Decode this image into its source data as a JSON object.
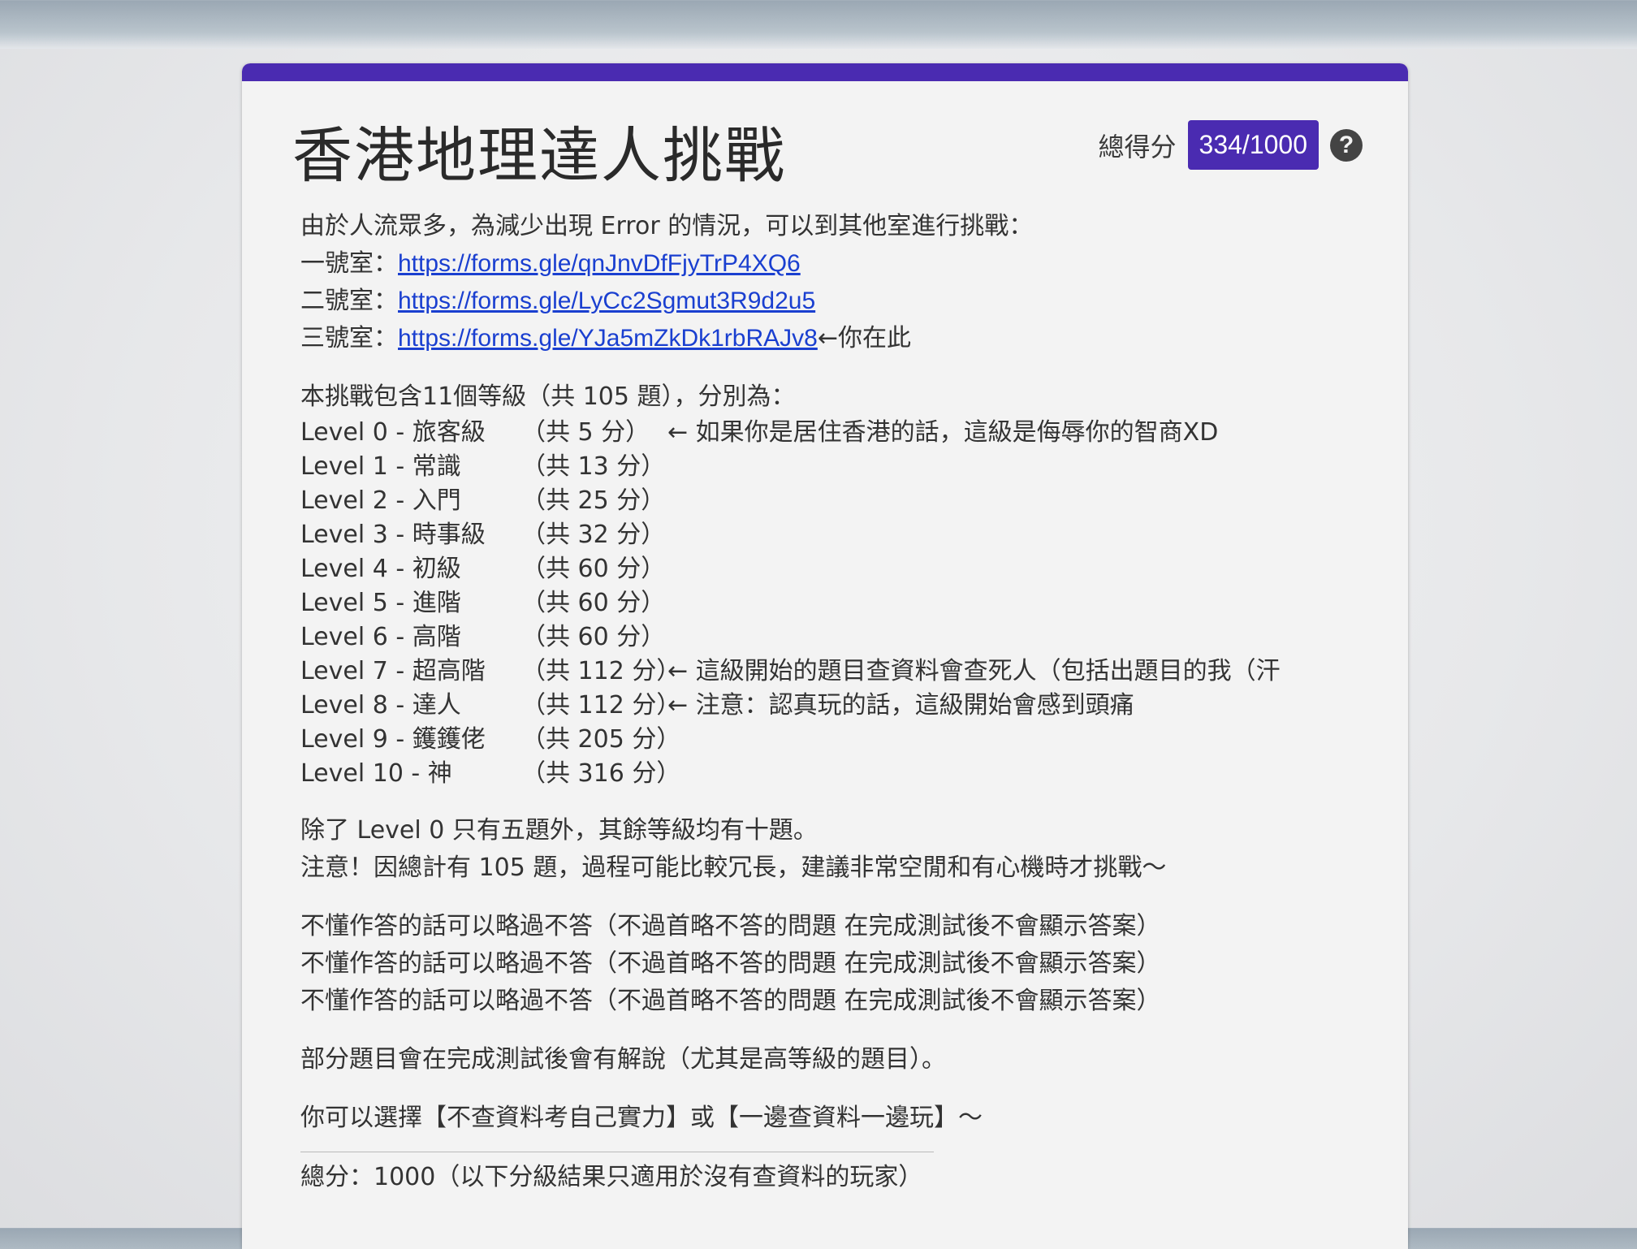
{
  "form": {
    "title": "香港地理達人挑戰",
    "score_label": "總得分",
    "score_value": "334/1000",
    "help_symbol": "?"
  },
  "rooms": {
    "intro": "由於人流眾多，為減少出現 Error 的情況，可以到其他室進行挑戰：",
    "items": [
      {
        "label": "一號室：",
        "url": "https://forms.gle/qnJnvDfFjyTrP4XQ6",
        "note": ""
      },
      {
        "label": "二號室：",
        "url": "https://forms.gle/LyCc2Sgmut3R9d2u5",
        "note": ""
      },
      {
        "label": "三號室：",
        "url": "https://forms.gle/YJa5mZkDk1rbRAJv8",
        "note": "←你在此"
      }
    ]
  },
  "levels": {
    "intro": "本挑戰包含11個等級（共 105 題），分別為：",
    "items": [
      {
        "name": "Level 0 - 旅客級",
        "points": "（共 5 分）",
        "note": "← 如果你是居住香港的話，這級是侮辱你的智商XD"
      },
      {
        "name": "Level 1 - 常識",
        "points": "（共 13 分）",
        "note": ""
      },
      {
        "name": "Level 2 - 入門",
        "points": "（共 25 分）",
        "note": ""
      },
      {
        "name": "Level 3 - 時事級",
        "points": "（共 32 分）",
        "note": ""
      },
      {
        "name": "Level 4 - 初級",
        "points": "（共 60 分）",
        "note": ""
      },
      {
        "name": "Level 5 - 進階",
        "points": "（共 60 分）",
        "note": ""
      },
      {
        "name": "Level 6 - 高階",
        "points": "（共 60 分）",
        "note": ""
      },
      {
        "name": "Level 7 - 超高階",
        "points": "（共 112 分）",
        "note": "← 這級開始的題目查資料會查死人（包括出題目的我（汗"
      },
      {
        "name": "Level 8 - 達人",
        "points": "（共 112 分）",
        "note": "← 注意：認真玩的話，這級開始會感到頭痛"
      },
      {
        "name": "Level 9 - 鑊鑊佬",
        "points": "（共 205 分）",
        "note": ""
      },
      {
        "name": "Level 10 - 神",
        "points": "（共 316 分）",
        "note": ""
      }
    ]
  },
  "notes": {
    "line1": "除了 Level 0 只有五題外，其餘等級均有十題。",
    "line2": "注意！因總計有 105 題，過程可能比較冗長，建議非常空閒和有心機時才挑戰～",
    "skip_lines": [
      "不懂作答的話可以略過不答（不過首略不答的問題 在完成測試後不會顯示答案）",
      "不懂作答的話可以略過不答（不過首略不答的問題 在完成測試後不會顯示答案）",
      "不懂作答的話可以略過不答（不過首略不答的問題 在完成測試後不會顯示答案）"
    ],
    "explain": "部分題目會在完成測試後會有解說（尤其是高等級的題目）。",
    "choice": "你可以選擇【不查資料考自己實力】或【一邊查資料一邊玩】～",
    "total": "總分：1000（以下分級結果只適用於沒有查資料的玩家）"
  }
}
